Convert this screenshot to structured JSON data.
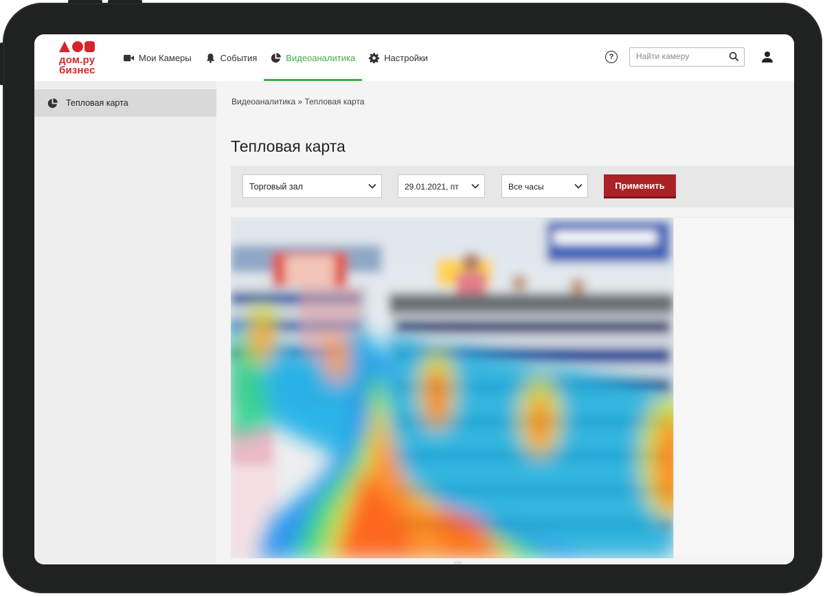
{
  "brand": {
    "line1": "дом.ру",
    "line2": "бизнес",
    "color": "#d6252a"
  },
  "nav": {
    "items": [
      {
        "label": "Мои Камеры",
        "icon": "video-camera-icon",
        "active": false
      },
      {
        "label": "События",
        "icon": "bell-icon",
        "active": false
      },
      {
        "label": "Видеоаналитика",
        "icon": "pie-chart-icon",
        "active": true
      },
      {
        "label": "Настройки",
        "icon": "gear-icon",
        "active": false
      }
    ],
    "accent": "#3fae49"
  },
  "header": {
    "help_icon": "question-circle-icon",
    "help_glyph": "?",
    "search_placeholder": "Найти камеру",
    "search_icon": "search-icon",
    "user_icon": "user-icon"
  },
  "sidebar": {
    "items": [
      {
        "label": "Тепловая карта",
        "icon": "pie-chart-icon",
        "active": true
      }
    ]
  },
  "main": {
    "breadcrumb": "Видеоаналитика » Тепловая карта",
    "title": "Тепловая карта",
    "filters": {
      "location": "Торговый зал",
      "date": "29.01.2021, пт",
      "hours": "Все часы"
    },
    "apply_label": "Применить",
    "apply_color": "#ab2226",
    "heatmap_image": "store-shelves-heatmap"
  }
}
